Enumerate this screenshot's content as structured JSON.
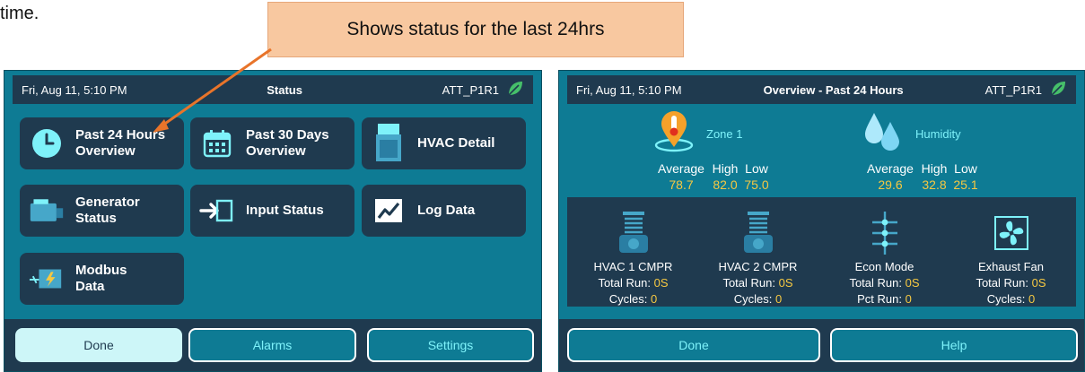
{
  "document": {
    "fragment_text": "time.",
    "callout_text": "Shows status for the last 24hrs"
  },
  "left_screen": {
    "header": {
      "date": "Fri, Aug 11, 5:10 PM",
      "title": "Status",
      "site": "ATT_P1R1",
      "logo_icon": "leaf-icon"
    },
    "tiles": [
      {
        "label": "Past 24 Hours\nOverview",
        "icon": "clock-icon"
      },
      {
        "label": "Past 30 Days\nOverview",
        "icon": "calendar-icon"
      },
      {
        "label": "HVAC Detail",
        "icon": "hvac-unit-icon"
      },
      {
        "label": "Generator\nStatus",
        "icon": "generator-icon"
      },
      {
        "label": "Input Status",
        "icon": "input-arrow-icon"
      },
      {
        "label": "Log Data",
        "icon": "trend-chart-icon"
      },
      {
        "label": "Modbus\nData",
        "icon": "modbus-icon"
      }
    ],
    "buttons": {
      "done": "Done",
      "alarms": "Alarms",
      "settings": "Settings"
    }
  },
  "right_screen": {
    "header": {
      "date": "Fri, Aug 11, 5:10 PM",
      "title": "Overview - Past 24 Hours",
      "site": "ATT_P1R1",
      "logo_icon": "leaf-icon"
    },
    "zone": {
      "name": "Zone 1",
      "headers": {
        "average": "Average",
        "high": "High",
        "low": "Low"
      },
      "values": {
        "average": "78.7",
        "high": "82.0",
        "low": "75.0"
      },
      "icon": "temperature-pin-icon"
    },
    "humidity": {
      "name": "Humidity",
      "headers": {
        "average": "Average",
        "high": "High",
        "low": "Low"
      },
      "values": {
        "average": "29.6",
        "high": "32.8",
        "low": "25.1"
      },
      "icon": "water-drops-icon"
    },
    "devices": [
      {
        "name": "HVAC 1 CMPR",
        "row1_label": "Total Run:",
        "row1_value": "0S",
        "row2_label": "Cycles:",
        "row2_value": "0",
        "icon": "compressor-icon"
      },
      {
        "name": "HVAC 2 CMPR",
        "row1_label": "Total Run:",
        "row1_value": "0S",
        "row2_label": "Cycles:",
        "row2_value": "0",
        "icon": "compressor-icon"
      },
      {
        "name": "Econ Mode",
        "row1_label": "Total Run:",
        "row1_value": "0S",
        "row2_label": "Pct Run:",
        "row2_value": "0",
        "icon": "econ-damper-icon"
      },
      {
        "name": "Exhaust Fan",
        "row1_label": "Total Run:",
        "row1_value": "0S",
        "row2_label": "Cycles:",
        "row2_value": "0",
        "icon": "fan-icon"
      }
    ],
    "buttons": {
      "done": "Done",
      "help": "Help"
    }
  },
  "colors": {
    "screen_bg": "#0e7b94",
    "panel_dark": "#1f3a4f",
    "accent_cyan": "#7ef2fa",
    "value_yellow": "#f5c842",
    "callout_bg": "#f8c8a0",
    "arrow": "#e8742a"
  }
}
